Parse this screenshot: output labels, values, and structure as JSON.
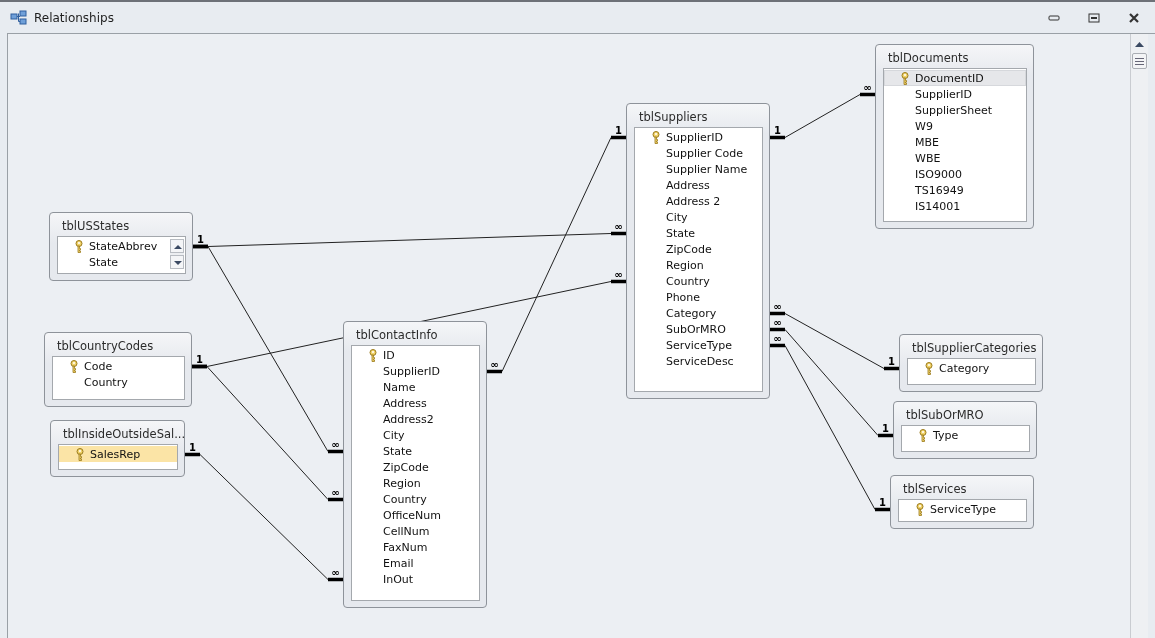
{
  "window": {
    "title": "Relationships"
  },
  "tables": [
    {
      "name": "tblUSStates",
      "scrollable": true,
      "fields": [
        {
          "name": "StateAbbrev",
          "key": true,
          "selected": false,
          "current": false
        },
        {
          "name": "State",
          "key": false,
          "selected": false,
          "current": false
        }
      ]
    },
    {
      "name": "tblCountryCodes",
      "fields": [
        {
          "name": "Code",
          "key": true,
          "selected": false,
          "current": false
        },
        {
          "name": "Country",
          "key": false,
          "selected": false,
          "current": false
        }
      ]
    },
    {
      "name": "tblInsideOutsideSal...",
      "fields": [
        {
          "name": "SalesRep",
          "key": true,
          "selected": true,
          "current": false
        }
      ]
    },
    {
      "name": "tblContactInfo",
      "fields": [
        {
          "name": "ID",
          "key": true,
          "selected": false,
          "current": false
        },
        {
          "name": "SupplierID",
          "key": false,
          "selected": false,
          "current": false
        },
        {
          "name": "Name",
          "key": false,
          "selected": false,
          "current": false
        },
        {
          "name": "Address",
          "key": false,
          "selected": false,
          "current": false
        },
        {
          "name": "Address2",
          "key": false,
          "selected": false,
          "current": false
        },
        {
          "name": "City",
          "key": false,
          "selected": false,
          "current": false
        },
        {
          "name": "State",
          "key": false,
          "selected": false,
          "current": false
        },
        {
          "name": "ZipCode",
          "key": false,
          "selected": false,
          "current": false
        },
        {
          "name": "Region",
          "key": false,
          "selected": false,
          "current": false
        },
        {
          "name": "Country",
          "key": false,
          "selected": false,
          "current": false
        },
        {
          "name": "OfficeNum",
          "key": false,
          "selected": false,
          "current": false
        },
        {
          "name": "CellNum",
          "key": false,
          "selected": false,
          "current": false
        },
        {
          "name": "FaxNum",
          "key": false,
          "selected": false,
          "current": false
        },
        {
          "name": "Email",
          "key": false,
          "selected": false,
          "current": false
        },
        {
          "name": "InOut",
          "key": false,
          "selected": false,
          "current": false
        }
      ]
    },
    {
      "name": "tblSuppliers",
      "fields": [
        {
          "name": "SupplierID",
          "key": true,
          "selected": false,
          "current": false
        },
        {
          "name": "Supplier Code",
          "key": false,
          "selected": false,
          "current": false
        },
        {
          "name": "Supplier Name",
          "key": false,
          "selected": false,
          "current": false
        },
        {
          "name": "Address",
          "key": false,
          "selected": false,
          "current": false
        },
        {
          "name": "Address 2",
          "key": false,
          "selected": false,
          "current": false
        },
        {
          "name": "City",
          "key": false,
          "selected": false,
          "current": false
        },
        {
          "name": "State",
          "key": false,
          "selected": false,
          "current": false
        },
        {
          "name": "ZipCode",
          "key": false,
          "selected": false,
          "current": false
        },
        {
          "name": "Region",
          "key": false,
          "selected": false,
          "current": false
        },
        {
          "name": "Country",
          "key": false,
          "selected": false,
          "current": false
        },
        {
          "name": "Phone",
          "key": false,
          "selected": false,
          "current": false
        },
        {
          "name": "Category",
          "key": false,
          "selected": false,
          "current": false
        },
        {
          "name": "SubOrMRO",
          "key": false,
          "selected": false,
          "current": false
        },
        {
          "name": "ServiceType",
          "key": false,
          "selected": false,
          "current": false
        },
        {
          "name": "ServiceDesc",
          "key": false,
          "selected": false,
          "current": false
        }
      ]
    },
    {
      "name": "tblDocuments",
      "fields": [
        {
          "name": "DocumentID",
          "key": true,
          "selected": false,
          "current": true
        },
        {
          "name": "SupplierID",
          "key": false,
          "selected": false,
          "current": false
        },
        {
          "name": "SupplierSheet",
          "key": false,
          "selected": false,
          "current": false
        },
        {
          "name": "W9",
          "key": false,
          "selected": false,
          "current": false
        },
        {
          "name": "MBE",
          "key": false,
          "selected": false,
          "current": false
        },
        {
          "name": "WBE",
          "key": false,
          "selected": false,
          "current": false
        },
        {
          "name": "ISO9000",
          "key": false,
          "selected": false,
          "current": false
        },
        {
          "name": "TS16949",
          "key": false,
          "selected": false,
          "current": false
        },
        {
          "name": "IS14001",
          "key": false,
          "selected": false,
          "current": false
        }
      ]
    },
    {
      "name": "tblSupplierCategories",
      "fields": [
        {
          "name": "Category",
          "key": true,
          "selected": false,
          "current": false
        }
      ]
    },
    {
      "name": "tblSubOrMRO",
      "fields": [
        {
          "name": "Type",
          "key": true,
          "selected": false,
          "current": false
        }
      ]
    },
    {
      "name": "tblServices",
      "fields": [
        {
          "name": "ServiceType",
          "key": true,
          "selected": false,
          "current": false
        }
      ]
    }
  ],
  "relationships": [
    {
      "to_label": "∞"
    },
    {
      "from_label": "1",
      "to_label": "∞"
    },
    {
      "to_label": "∞"
    },
    {
      "from_label": "1",
      "to_label": "∞"
    },
    {
      "from_label": "1",
      "to_label": "∞"
    },
    {
      "from_label": "1",
      "to_label": "∞"
    },
    {
      "from_label": "1",
      "to_label": "∞"
    },
    {
      "from_label": "1",
      "to_label": "∞"
    },
    {
      "from_label": "1",
      "to_label": "∞"
    },
    {
      "from_label": "1",
      "to_label": "∞"
    }
  ]
}
